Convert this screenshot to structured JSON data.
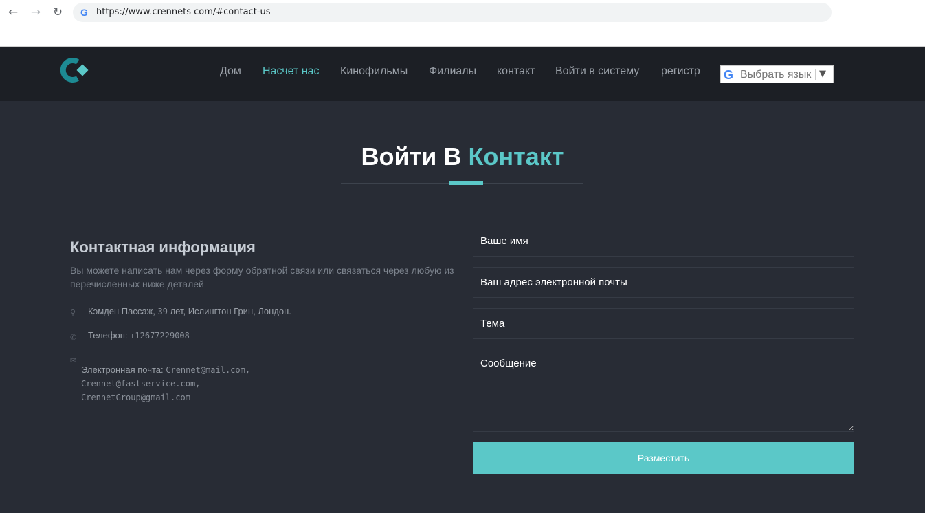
{
  "browser": {
    "url": "https://www.crennets com/#contact-us",
    "back_icon": "arrow-left-icon",
    "forward_icon": "arrow-right-icon",
    "reload_icon": "reload-icon"
  },
  "nav": {
    "items": [
      {
        "label": "Дом"
      },
      {
        "label": "Насчет нас",
        "active": true
      },
      {
        "label": "Кинофильмы"
      },
      {
        "label": "Филиалы"
      },
      {
        "label": "контакт"
      },
      {
        "label": "Войти в систему"
      },
      {
        "label": "регистр"
      }
    ],
    "language_select": "Выбрать язык"
  },
  "section": {
    "title_main": "Войти В",
    "title_accent": "Контакт"
  },
  "contact_info": {
    "heading": "Контактная информация",
    "description": "Вы можете написать нам через форму обратной связи или связаться через любую из перечисленных ниже деталей",
    "address_label": "Кэмден Пассаж,",
    "address_number": "39",
    "address_rest": "лет, Ислингтон Грин, Лондон.",
    "phone_label": "Телефон:",
    "phone_value": "+12677229008",
    "email_label": "Электронная почта:",
    "email_value_1": "Crennet@mail.com, Crennet@fastservice.com,",
    "email_value_2": "CrennetGroup@gmail.com"
  },
  "form": {
    "name_placeholder": "Ваше имя",
    "email_placeholder": "Ваш адрес электронной почты",
    "subject_placeholder": "Тема",
    "message_placeholder": "Сообщение",
    "submit_label": "Разместить"
  },
  "colors": {
    "accent": "#5bc8c8",
    "background": "#282c35",
    "header_background": "#1c1f25"
  }
}
